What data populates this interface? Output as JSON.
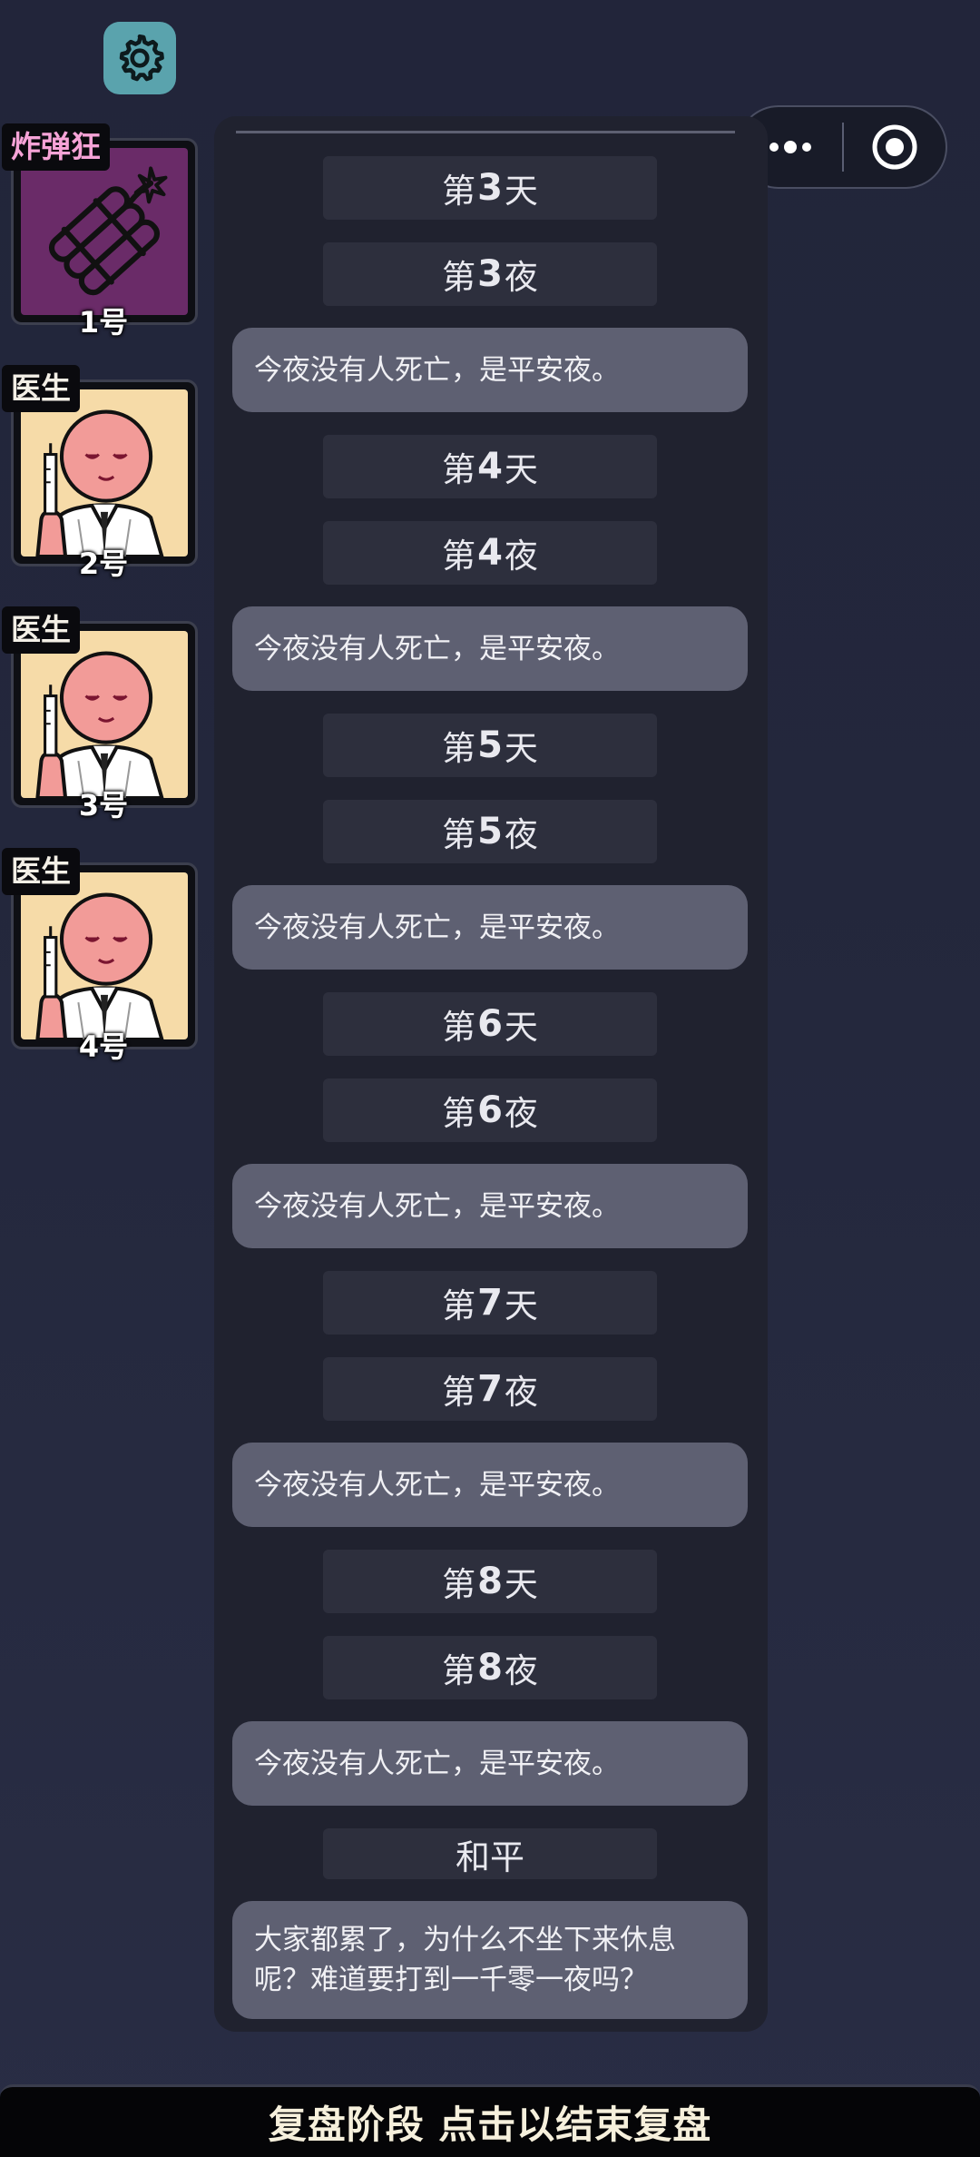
{
  "capsule": {
    "more_icon": "more-dots-icon",
    "close_icon": "target-circle-icon"
  },
  "settings": {
    "icon": "gear-icon"
  },
  "players": [
    {
      "role": "炸弹狂",
      "number": "1号",
      "art": "dynamite-icon",
      "role_color": "#f6a3d7",
      "bg": "#6a2b68"
    },
    {
      "role": "医生",
      "number": "2号",
      "art": "doctor-avatar",
      "role_color": "#f3efe6",
      "bg": "#f6dba8"
    },
    {
      "role": "医生",
      "number": "3号",
      "art": "doctor-avatar",
      "role_color": "#f3efe6",
      "bg": "#f6dba8"
    },
    {
      "role": "医生",
      "number": "4号",
      "art": "doctor-avatar",
      "role_color": "#f3efe6",
      "bg": "#f6dba8"
    }
  ],
  "log": {
    "d3": {
      "pre": "第",
      "n": "3",
      "post": "天"
    },
    "n3": {
      "pre": "第",
      "n": "3",
      "post": "夜"
    },
    "m3": "今夜没有人死亡，是平安夜。",
    "d4": {
      "pre": "第",
      "n": "4",
      "post": "天"
    },
    "n4": {
      "pre": "第",
      "n": "4",
      "post": "夜"
    },
    "m4": "今夜没有人死亡，是平安夜。",
    "d5": {
      "pre": "第",
      "n": "5",
      "post": "天"
    },
    "n5": {
      "pre": "第",
      "n": "5",
      "post": "夜"
    },
    "m5": "今夜没有人死亡，是平安夜。",
    "d6": {
      "pre": "第",
      "n": "6",
      "post": "天"
    },
    "n6": {
      "pre": "第",
      "n": "6",
      "post": "夜"
    },
    "m6": "今夜没有人死亡，是平安夜。",
    "d7": {
      "pre": "第",
      "n": "7",
      "post": "天"
    },
    "n7": {
      "pre": "第",
      "n": "7",
      "post": "夜"
    },
    "m7": "今夜没有人死亡，是平安夜。",
    "d8": {
      "pre": "第",
      "n": "8",
      "post": "天"
    },
    "n8": {
      "pre": "第",
      "n": "8",
      "post": "夜"
    },
    "m8": "今夜没有人死亡，是平安夜。",
    "peace": "和平",
    "final_line1": "大家都累了，为什么不坐下来休息",
    "final_line2": "呢？难道要打到一千零一夜吗？"
  },
  "bottom_bar": {
    "label": "复盘阶段 点击以结束复盘"
  }
}
